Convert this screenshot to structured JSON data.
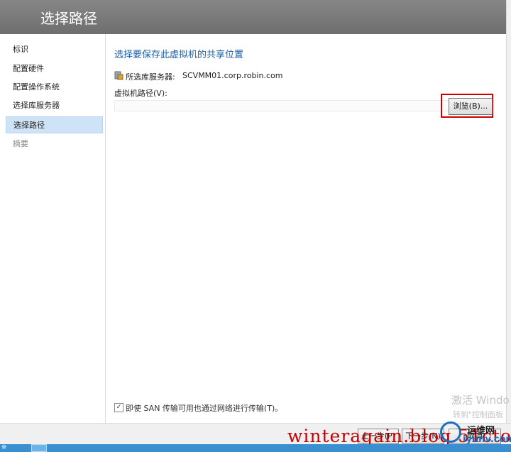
{
  "window": {
    "title": "选择路径"
  },
  "sidebar": {
    "items": [
      {
        "label": "标识",
        "state": "normal"
      },
      {
        "label": "配置硬件",
        "state": "normal"
      },
      {
        "label": "配置操作系统",
        "state": "normal"
      },
      {
        "label": "选择库服务器",
        "state": "normal"
      },
      {
        "label": "选择路径",
        "state": "active"
      },
      {
        "label": "摘要",
        "state": "disabled"
      }
    ]
  },
  "main": {
    "section_title": "选择要保存此虚拟机的共享位置",
    "library_server_label": "所选库服务器:",
    "library_server_value": "SCVMM01.corp.robin.com",
    "vm_path_label": "虚拟机路径(V):",
    "vm_path_value": "",
    "browse_label": "浏览(B)...",
    "san_checkbox_checked": true,
    "san_checkbox_mark": "✓",
    "san_label": "即使 SAN 传输可用也通过网络进行传输(T)。"
  },
  "footer": {
    "prev_label": "上一步(P)",
    "next_label": "下一步(N)",
    "cancel_label": "取消"
  },
  "overlay": {
    "activate_windows": "激活 Windo",
    "activate_hint": "转到\"控制面板",
    "blog_watermark": "winteragain.blog.51cto.",
    "site_name": "运维网",
    "site_url": "iyunv.com"
  },
  "taskbar": {
    "left_icon": "⛯"
  },
  "colors": {
    "header": "#7a7a7a",
    "accent_title": "#1c5fa8",
    "nav_active": "#cfe3f7",
    "highlight_box": "#d00000",
    "taskbar": "#3a8fd0"
  }
}
